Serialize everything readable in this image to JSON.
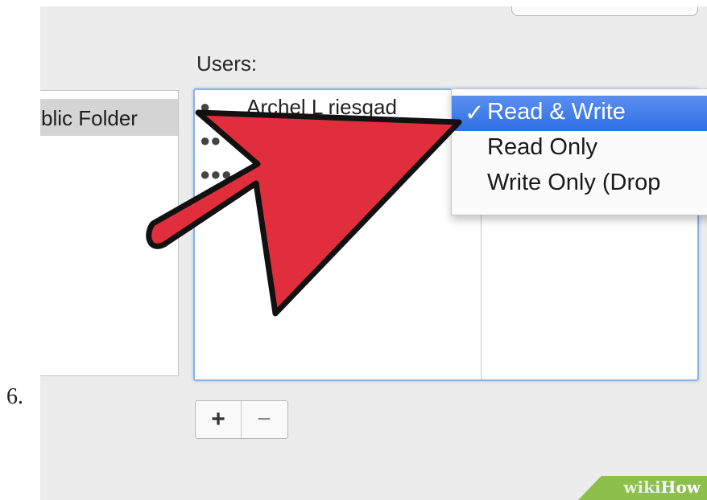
{
  "step": {
    "number": "6."
  },
  "dialog": {
    "left_column_label": ":",
    "users_label": "Users:"
  },
  "folders": [
    {
      "name": "blic Folder",
      "selected": true
    }
  ],
  "users": [
    {
      "name": "Archel L riesgad",
      "icon": "person-icon"
    },
    {
      "name": "",
      "icon": "group-icon"
    },
    {
      "name": "",
      "icon": "group-icon"
    }
  ],
  "permission_menu": {
    "items": [
      {
        "label": "Read & Write",
        "checked": true
      },
      {
        "label": "Read Only",
        "checked": false
      },
      {
        "label": "Write Only (Drop",
        "checked": false
      }
    ],
    "check_glyph": "✓"
  },
  "buttons": {
    "add_label": "+",
    "remove_label": "−"
  },
  "watermark": {
    "part1": "wiki",
    "part2": "How",
    "color": "#8cbf4b"
  },
  "colors": {
    "arrow_fill": "#e02e3c",
    "selection_blue": "#3a78e8",
    "focus_ring": "#8db2e0"
  }
}
